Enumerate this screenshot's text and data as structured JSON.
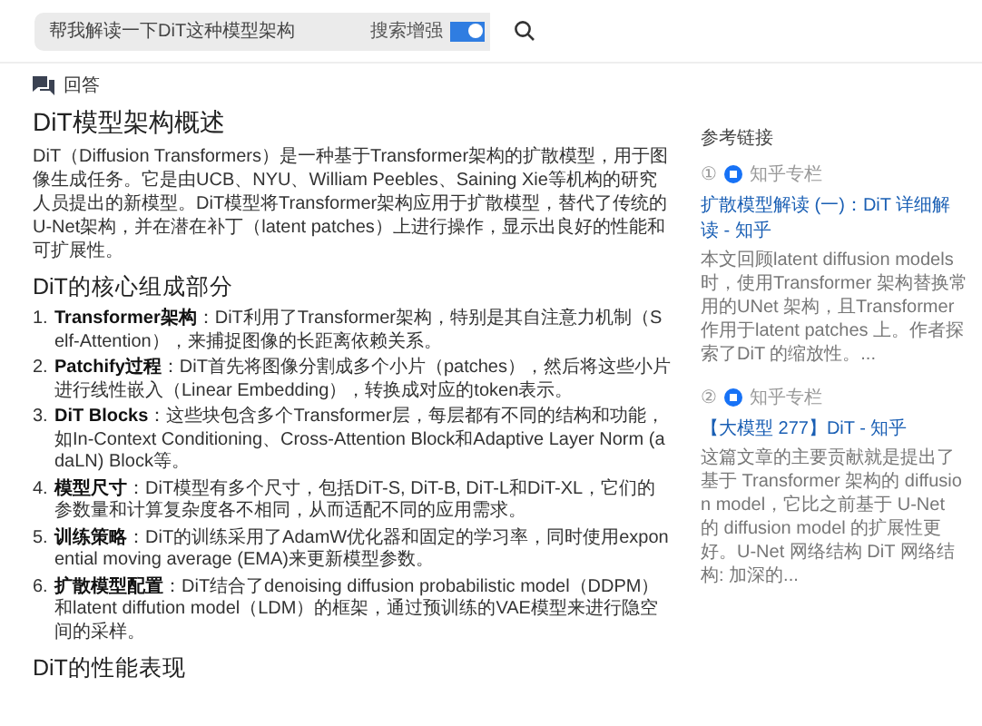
{
  "search": {
    "value": "帮我解读一下DiT这种模型架构",
    "enhance_label": "搜索增强",
    "enhance_on": true
  },
  "answer_label": "回答",
  "title": "DiT模型架构概述",
  "intro": "DiT（Diffusion Transformers）是一种基于Transformer架构的扩散模型，用于图像生成任务。它是由UCB、NYU、William Peebles、Saining Xie等机构的研究人员提出的新模型。DiT模型将Transformer架构应用于扩散模型，替代了传统的U-Net架构，并在潜在补丁（latent patches）上进行操作，显示出良好的性能和可扩展性。",
  "section_heading": "DiT的核心组成部分",
  "components": [
    {
      "number": "1.",
      "text": "**Transformer架构**：DiT利用了Transformer架构，特别是其自注意力机制（Self-Attention），来捕捉图像的长距离依赖关系。"
    },
    {
      "number": "2.",
      "text": "**Patchify过程**：DiT首先将图像分割成多个小片（patches），然后将这些小片进行线性嵌入（Linear Embedding），转换成对应的token表示。"
    },
    {
      "number": "3.",
      "text": "**DiT Blocks**：这些块包含多个Transformer层，每层都有不同的结构和功能，如In-Context Conditioning、Cross-Attention Block和Adaptive Layer Norm (adaLN) Block等。"
    },
    {
      "number": "4.",
      "text": "**模型尺寸**：DiT模型有多个尺寸，包括DiT-S, DiT-B, DiT-L和DiT-XL，它们的参数量和计算复杂度各不相同，从而适配不同的应用需求。"
    },
    {
      "number": "5.",
      "text": "**训练策略**：DiT的训练采用了AdamW优化器和固定的学习率，同时使用exponential moving average (EMA)来更新模型参数。"
    },
    {
      "number": "6.",
      "text": "**扩散模型配置**：DiT结合了denoising diffusion probabilistic model（DDPM）和latent diffution model（LDM）的框架，通过预训练的VAE模型来进行隐空间的采样。"
    }
  ],
  "performance_heading": "DiT的性能表现",
  "references": {
    "heading": "参考链接",
    "items": [
      {
        "number": "①",
        "source": "知乎专栏",
        "title": "扩散模型解读 (一)：DiT 详细解读 - 知乎",
        "snippet": "本文回顾latent diffusion models 时，使用Transformer 架构替换常用的UNet 架构，且Transformer 作用于latent patches 上。作者探索了DiT 的缩放性。..."
      },
      {
        "number": "②",
        "source": "知乎专栏",
        "title": "【大模型 277】DiT - 知乎",
        "snippet": "这篇文章的主要贡献就是提出了基于 Transformer 架构的 diffusion model，它比之前基于 U-Net 的 diffusion model 的扩展性更好。U-Net 网络结构 DiT 网络结构: 加深的..."
      }
    ]
  }
}
